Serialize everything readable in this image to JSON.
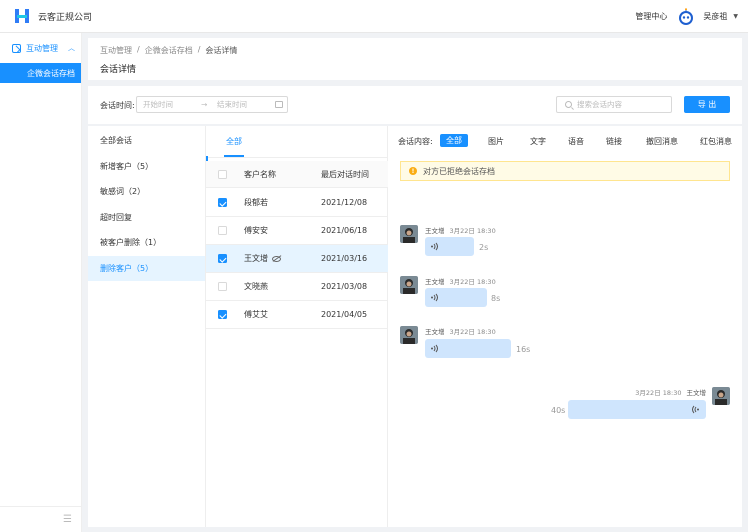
{
  "header": {
    "company_name": "云客正规公司",
    "mgmt_center": "管理中心",
    "username": "吴彦祖"
  },
  "sidebar": {
    "group_label": "互动管理",
    "items": [
      {
        "label": "企微会话存档",
        "active": true
      }
    ]
  },
  "breadcrumb": [
    "互动管理",
    "企微会话存档",
    "会话详情"
  ],
  "page_title": "会话详情",
  "filter": {
    "label": "会话时间:",
    "start_placeholder": "开始时间",
    "end_placeholder": "结束时间",
    "search_placeholder": "搜索会话内容",
    "export_label": "导 出"
  },
  "categories": [
    {
      "label": "全部会话"
    },
    {
      "label": "新增客户（5）"
    },
    {
      "label": "敏感词（2）"
    },
    {
      "label": "超时回复"
    },
    {
      "label": "被客户删除（1）"
    },
    {
      "label": "删除客户（5）",
      "active": true
    }
  ],
  "customer_list": {
    "tab_label": "全部",
    "columns": [
      "客户名称",
      "最后对话时间"
    ],
    "rows": [
      {
        "name": "段郁若",
        "time": "2021/12/08",
        "checked": true
      },
      {
        "name": "傅安安",
        "time": "2021/06/18",
        "checked": false
      },
      {
        "name": "王文增",
        "time": "2021/03/16",
        "checked": true,
        "selected": true
      },
      {
        "name": "文晓燕",
        "time": "2021/03/08",
        "checked": false
      },
      {
        "name": "傅艾艾",
        "time": "2021/04/05",
        "checked": true
      }
    ]
  },
  "chat": {
    "content_label": "会话内容:",
    "types": [
      "全部",
      "图片",
      "文字",
      "语音",
      "链接",
      "撤回消息",
      "红包消息"
    ],
    "active_type": "全部",
    "notice": "对方已拒绝会话存档",
    "messages": [
      {
        "sender": "王文增",
        "date": "3月22日 18:30",
        "duration": "2s",
        "side": "left"
      },
      {
        "sender": "王文增",
        "date": "3月22日 18:30",
        "duration": "8s",
        "side": "left"
      },
      {
        "sender": "王文增",
        "date": "3月22日 18:30",
        "duration": "16s",
        "side": "left"
      },
      {
        "sender": "王文增",
        "date": "3月22日 18:30",
        "duration": "40s",
        "side": "right"
      }
    ]
  },
  "colors": {
    "accent": "#1890ff",
    "bubble": "#cfe5fd",
    "warning": "#faad14"
  }
}
